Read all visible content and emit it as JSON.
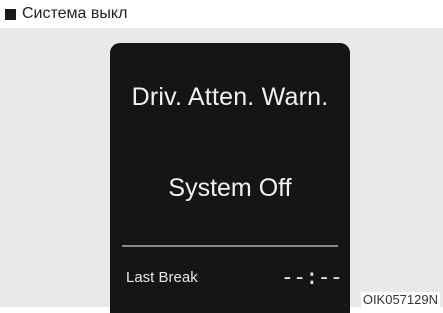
{
  "heading": {
    "text": "Система выкл"
  },
  "display": {
    "title": "Driv. Atten. Warn.",
    "status": "System Off",
    "last_break_label": "Last Break",
    "last_break_value": "--:--"
  },
  "image_code": "OIK057129N",
  "colors": {
    "display_background": "#151515",
    "panel_background": "#e9e9e9",
    "display_text": "#f1f1f1"
  }
}
